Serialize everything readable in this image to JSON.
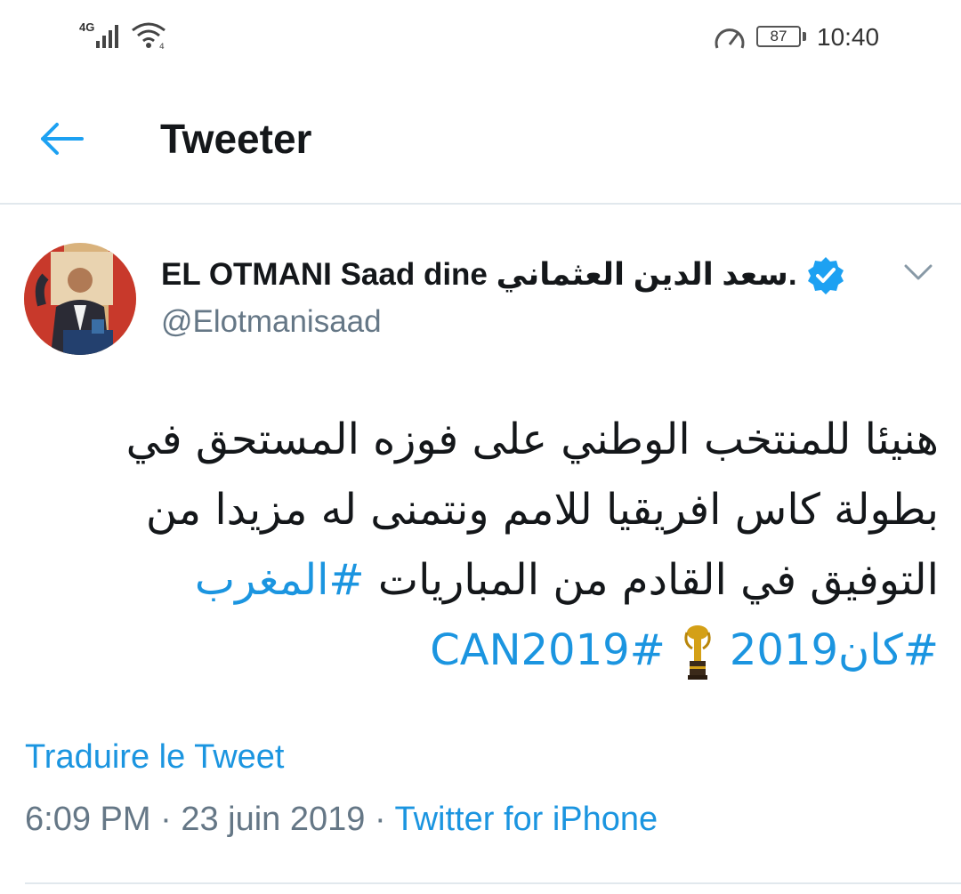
{
  "status_bar": {
    "network_label": "4G",
    "battery_level": "87",
    "time": "10:40"
  },
  "header": {
    "title": "Tweeter"
  },
  "tweet": {
    "display_name": "EL OTMANI Saad dine سعد الدين العثماني.",
    "handle": "@Elotmanisaad",
    "text_lines": [
      "هنيئا للمنتخب الوطني على فوزه المستحق في",
      "بطولة كاس افريقيا للامم ونتمنى له مزيدا من",
      "التوفيق في القادم من المباريات"
    ],
    "hashtag_maghreb": "#المغرب",
    "hashtag_can_ar": "#كان2019",
    "hashtag_can": "#CAN2019",
    "translate_label": "Traduire le Tweet",
    "time": "6:09 PM",
    "date": "23 juin 2019",
    "separator": " · ",
    "source": "Twitter for iPhone"
  },
  "colors": {
    "link": "#1b95e0",
    "secondary_text": "#657786",
    "divider": "#e1e8ed"
  }
}
